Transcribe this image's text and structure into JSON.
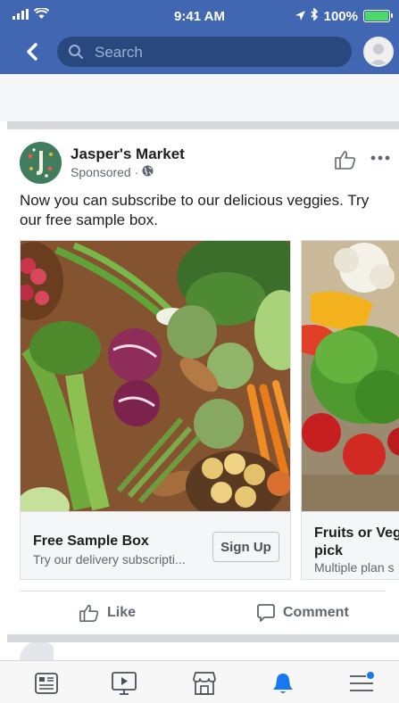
{
  "status_bar": {
    "time": "9:41 AM",
    "battery": "100%",
    "battery_level": 1.0
  },
  "nav": {
    "search_placeholder": "Search",
    "back_icon": "chevron-left-icon",
    "avatar_icon": "profile-avatar"
  },
  "post": {
    "page_name": "Jasper's Market",
    "sponsored_label": "Sponsored",
    "sponsored_separator": "·",
    "body_text": "Now you can subscribe to our delicious veggies. Try our free sample box.",
    "actions": {
      "like_label": "Like",
      "comment_label": "Comment"
    }
  },
  "carousel": [
    {
      "title": "Free Sample Box",
      "description": "Try our delivery subscripti...",
      "cta_label": "Sign Up"
    },
    {
      "title": "Fruits or Veg\npick",
      "description": "Multiple plan s"
    }
  ],
  "tabbar": {
    "items": [
      "news-feed-icon",
      "watch-video-icon",
      "marketplace-icon",
      "notifications-bell-icon",
      "menu-icon"
    ],
    "active_item": "notifications-bell-icon"
  },
  "colors": {
    "brand_blue": "#4267b2",
    "search_bg": "#29487d",
    "active_tab": "#1877f2",
    "secondary_text": "#606770"
  }
}
